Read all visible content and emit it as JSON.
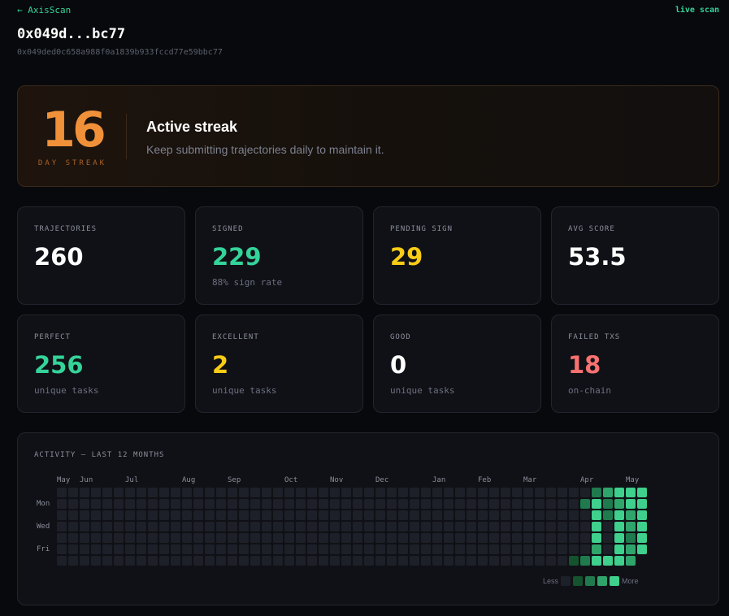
{
  "header": {
    "back_label": "← AxisScan",
    "live_label": "live scan",
    "address_short": "0x049d...bc77",
    "address_full": "0x049ded0c658a988f0a1839b933fccd77e59bbc77"
  },
  "streak": {
    "days": "16",
    "label": "DAY STREAK",
    "title": "Active streak",
    "subtitle": "Keep submitting trajectories daily to maintain it."
  },
  "stats": [
    {
      "label": "TRAJECTORIES",
      "value": "260",
      "sub": "",
      "color": "#ffffff"
    },
    {
      "label": "SIGNED",
      "value": "229",
      "sub": "88% sign rate",
      "color": "#34d399"
    },
    {
      "label": "PENDING SIGN",
      "value": "29",
      "sub": "",
      "color": "#facc15"
    },
    {
      "label": "AVG SCORE",
      "value": "53.5",
      "sub": "",
      "color": "#ffffff"
    },
    {
      "label": "PERFECT",
      "value": "256",
      "sub": "unique tasks",
      "color": "#34d399"
    },
    {
      "label": "EXCELLENT",
      "value": "2",
      "sub": "unique tasks",
      "color": "#facc15"
    },
    {
      "label": "GOOD",
      "value": "0",
      "sub": "unique tasks",
      "color": "#ffffff"
    },
    {
      "label": "FAILED TXS",
      "value": "18",
      "sub": "on-chain",
      "color": "#f87171"
    }
  ],
  "activity": {
    "title": "ACTIVITY — LAST 12 MONTHS",
    "months": [
      "May",
      "Jun",
      "Jul",
      "Aug",
      "Sep",
      "Oct",
      "Nov",
      "Dec",
      "Jan",
      "Feb",
      "Mar",
      "Apr",
      "May"
    ],
    "days": [
      "Mon",
      "Wed",
      "Fri"
    ],
    "legend_less": "Less",
    "legend_more": "More",
    "level_colors": [
      "#1e2029",
      "#14532d",
      "#1f7a4d",
      "#2fa56b",
      "#3ed08c"
    ],
    "weeks": 52,
    "levels": [
      [
        45,
        6,
        1
      ],
      [
        46,
        1,
        2
      ],
      [
        46,
        6,
        2
      ],
      [
        47,
        0,
        2
      ],
      [
        47,
        1,
        4
      ],
      [
        47,
        2,
        4
      ],
      [
        47,
        3,
        4
      ],
      [
        47,
        4,
        4
      ],
      [
        47,
        5,
        3
      ],
      [
        47,
        6,
        4
      ],
      [
        48,
        0,
        3
      ],
      [
        48,
        1,
        2
      ],
      [
        48,
        2,
        2
      ],
      [
        48,
        6,
        4
      ],
      [
        49,
        0,
        4
      ],
      [
        49,
        1,
        3
      ],
      [
        49,
        2,
        4
      ],
      [
        49,
        3,
        4
      ],
      [
        49,
        4,
        4
      ],
      [
        49,
        5,
        4
      ],
      [
        49,
        6,
        4
      ],
      [
        50,
        0,
        4
      ],
      [
        50,
        1,
        4
      ],
      [
        50,
        2,
        3
      ],
      [
        50,
        3,
        3
      ],
      [
        50,
        4,
        2
      ],
      [
        50,
        5,
        3
      ],
      [
        50,
        6,
        3
      ],
      [
        51,
        0,
        4
      ],
      [
        51,
        1,
        4
      ],
      [
        51,
        2,
        4
      ],
      [
        51,
        3,
        4
      ],
      [
        51,
        4,
        4
      ],
      [
        51,
        5,
        4
      ]
    ]
  }
}
